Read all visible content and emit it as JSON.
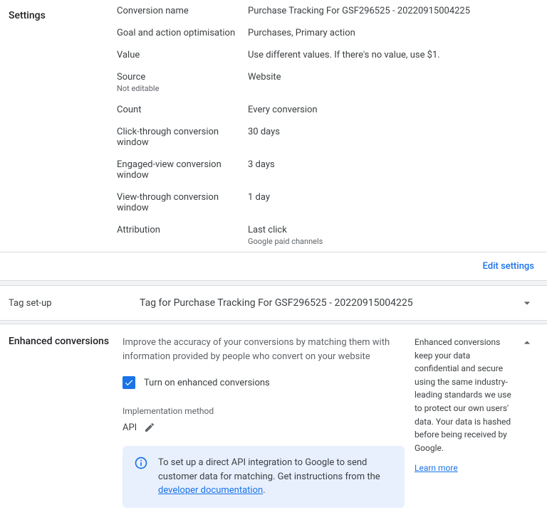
{
  "settings": {
    "heading": "Settings",
    "rows": [
      {
        "label": "Conversion name",
        "value": "Purchase Tracking For GSF296525 - 20220915004225"
      },
      {
        "label": "Goal and action optimisation",
        "value": "Purchases, Primary action"
      },
      {
        "label": "Value",
        "value": "Use different values. If there's no value, use $1."
      },
      {
        "label": "Source",
        "sublabel": "Not editable",
        "value": "Website"
      },
      {
        "label": "Count",
        "value": "Every conversion"
      },
      {
        "label": "Click-through conversion window",
        "value": "30 days"
      },
      {
        "label": "Engaged-view conversion window",
        "value": "3 days"
      },
      {
        "label": "View-through conversion window",
        "value": "1 day"
      },
      {
        "label": "Attribution",
        "value": "Last click",
        "subvalue": "Google paid channels"
      }
    ],
    "edit_link": "Edit settings"
  },
  "tag_setup": {
    "heading": "Tag set-up",
    "title": "Tag for Purchase Tracking For GSF296525 - 20220915004225"
  },
  "enhanced": {
    "heading": "Enhanced conversions",
    "description": "Improve the accuracy of your conversions by matching them with information provided by people who convert on your website",
    "checkbox_label": "Turn on enhanced conversions",
    "impl_label": "Implementation method",
    "impl_value": "API",
    "info_pre": "To set up a direct API integration to Google to send customer data for matching. Get instructions from the ",
    "info_link": "developer documentation",
    "info_post": ".",
    "side_text": "Enhanced conversions keep your data confidential and secure using the same industry-leading standards we use to protect our own users' data. Your data is hashed before being received by Google.",
    "learn_more": "Learn more"
  }
}
